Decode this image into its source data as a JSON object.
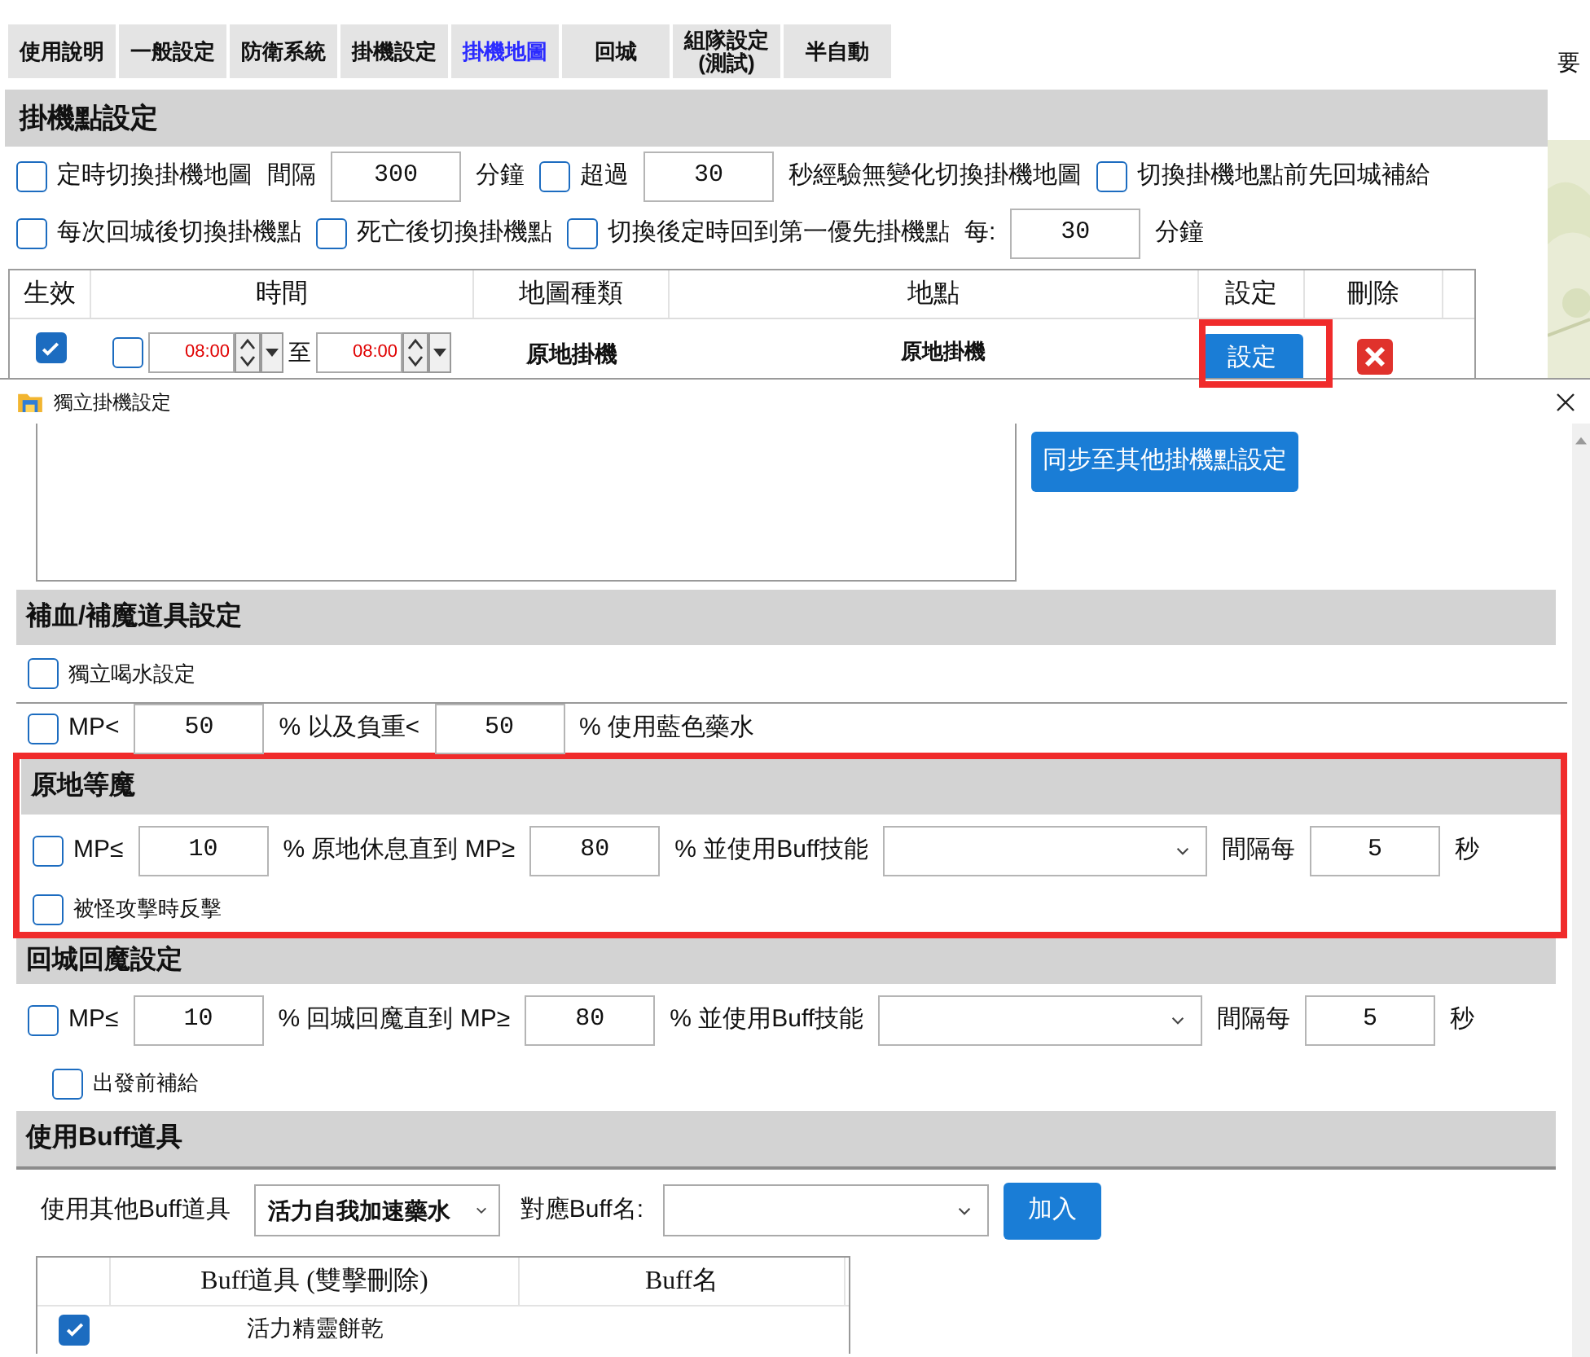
{
  "tabs": [
    {
      "label": "使用說明",
      "selected": false
    },
    {
      "label": "一般設定",
      "selected": false
    },
    {
      "label": "防衛系統",
      "selected": false
    },
    {
      "label": "掛機設定",
      "selected": false
    },
    {
      "label": "掛機地圖",
      "selected": true
    },
    {
      "label": "回城",
      "selected": false
    },
    {
      "label": "組隊設定 (測試)",
      "selected": false
    },
    {
      "label": "半自動",
      "selected": false
    }
  ],
  "edge_text": "要",
  "hang_points": {
    "title": "掛機點設定",
    "option_rows": [
      [
        {
          "kind": "checkbox",
          "label": "定時切換掛機地圖",
          "checked": false
        },
        {
          "kind": "text",
          "text": "間隔"
        },
        {
          "kind": "field",
          "value": "300"
        },
        {
          "kind": "text",
          "text": "分鐘"
        },
        {
          "kind": "checkbox",
          "label": "超過",
          "checked": false
        },
        {
          "kind": "field",
          "value": "30"
        },
        {
          "kind": "text",
          "text": "秒經驗無變化切換掛機地圖"
        },
        {
          "kind": "checkbox",
          "label": "切換掛機地點前先回城補給",
          "checked": false
        }
      ],
      [
        {
          "kind": "checkbox",
          "label": "每次回城後切換掛機點",
          "checked": false
        },
        {
          "kind": "checkbox",
          "label": "死亡後切換掛機點",
          "checked": false
        },
        {
          "kind": "checkbox",
          "label": "切換後定時回到第一優先掛機點",
          "checked": false
        },
        {
          "kind": "text",
          "text": "每:"
        },
        {
          "kind": "field",
          "value": "30"
        },
        {
          "kind": "text",
          "text": "分鐘"
        }
      ]
    ],
    "table": {
      "columns": [
        "生效",
        "時間",
        "地圖種類",
        "地點",
        "設定",
        "刪除"
      ],
      "rows": [
        {
          "enabled": true,
          "timed": false,
          "from": "08:00",
          "separator": "至",
          "to": "08:00",
          "map_type": "原地掛機",
          "place": "原地掛機",
          "button": "設定",
          "highlighted": true
        }
      ]
    }
  },
  "dialog": {
    "title": "獨立掛機設定",
    "sync_button": "同步至其他掛機點設定",
    "sections": [
      {
        "title": "補血/補魔道具設定",
        "highlighted": false,
        "rows": [
          {
            "kind": "option",
            "items": [
              {
                "kind": "checkbox",
                "label": "獨立喝水設定",
                "checked": false
              }
            ]
          },
          {
            "kind": "line",
            "items": [
              {
                "kind": "checkbox",
                "label": "MP<",
                "checked": false
              },
              {
                "kind": "field",
                "value": "50"
              },
              {
                "kind": "text",
                "text": "% 以及負重<"
              },
              {
                "kind": "field",
                "value": "50"
              },
              {
                "kind": "text",
                "text": "% 使用藍色藥水"
              }
            ]
          }
        ]
      },
      {
        "title": "原地等魔",
        "highlighted": true,
        "rows": [
          {
            "kind": "line",
            "items": [
              {
                "kind": "checkbox",
                "label": "MP≤",
                "checked": false
              },
              {
                "kind": "field",
                "value": "10"
              },
              {
                "kind": "text",
                "text": "% 原地休息直到 MP≥"
              },
              {
                "kind": "field",
                "value": "80"
              },
              {
                "kind": "text",
                "text": "% 並使用Buff技能"
              },
              {
                "kind": "select"
              },
              {
                "kind": "text",
                "text": "間隔每"
              },
              {
                "kind": "field",
                "value": "5"
              },
              {
                "kind": "text",
                "text": "秒"
              }
            ]
          },
          {
            "kind": "option",
            "items": [
              {
                "kind": "checkbox",
                "label": "被怪攻擊時反擊",
                "checked": false
              }
            ]
          }
        ]
      },
      {
        "title": "回城回魔設定",
        "highlighted": false,
        "rows": [
          {
            "kind": "line",
            "items": [
              {
                "kind": "checkbox",
                "label": "MP≤",
                "checked": false
              },
              {
                "kind": "field",
                "value": "10"
              },
              {
                "kind": "text",
                "text": "% 回城回魔直到 MP≥"
              },
              {
                "kind": "field",
                "value": "80"
              },
              {
                "kind": "text",
                "text": "% 並使用Buff技能"
              },
              {
                "kind": "select"
              },
              {
                "kind": "text",
                "text": "間隔每"
              },
              {
                "kind": "field",
                "value": "5"
              },
              {
                "kind": "text",
                "text": "秒"
              }
            ]
          },
          {
            "kind": "sub",
            "items": [
              {
                "kind": "checkbox",
                "label": "出發前補給",
                "checked": false
              }
            ]
          }
        ]
      }
    ],
    "buff_items": {
      "title": "使用Buff道具",
      "item_label": "使用其他Buff道具",
      "item_select": "活力自我加速藥水",
      "name_label": "對應Buff名:",
      "add_button": "加入",
      "table": {
        "columns": [
          "Buff道具 (雙擊刪除)",
          "Buff名"
        ],
        "rows": [
          {
            "checked": true,
            "item": "活力精靈餅乾"
          }
        ]
      }
    }
  }
}
